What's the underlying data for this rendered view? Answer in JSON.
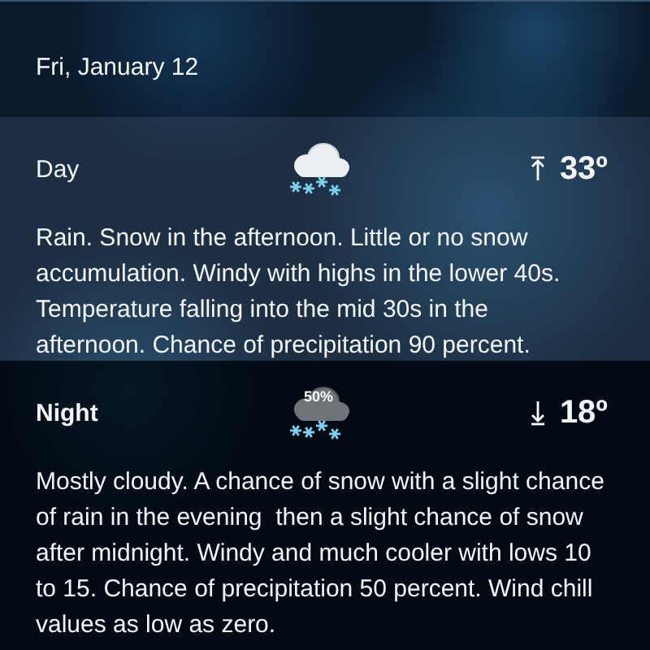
{
  "date": "Fri, January 12",
  "periods": [
    {
      "kind": "day",
      "label": "Day",
      "temperature": "33º",
      "description": "Rain. Snow in the afternoon. Little or no snow accumulation. Windy with highs in the lower 40s. Temperature falling into the mid 30s in the afternoon. Chance of precipitation 90 percent."
    },
    {
      "kind": "night",
      "label": "Night",
      "icon_badge": "50%",
      "temperature": "18º",
      "description": "Mostly cloudy. A chance of snow with a slight chance of rain in the evening  then a slight chance of snow after midnight. Windy and much cooler with lows 10 to 15. Chance of precipitation 50 percent. Wind chill values as low as zero."
    }
  ]
}
